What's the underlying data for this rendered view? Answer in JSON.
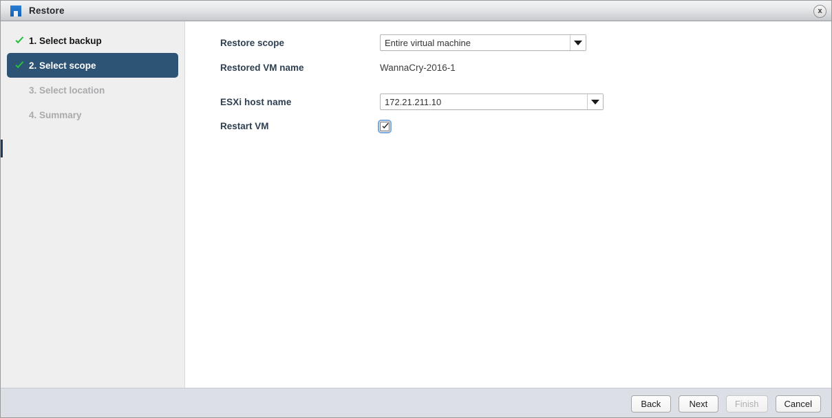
{
  "window": {
    "title": "Restore",
    "app_icon": "restore-app-icon",
    "close_icon": "close-icon",
    "close_label": "x"
  },
  "sidebar": {
    "steps": [
      {
        "label": "1. Select backup",
        "state": "done",
        "icon": "check-icon"
      },
      {
        "label": "2. Select scope",
        "state": "active",
        "icon": "check-icon"
      },
      {
        "label": "3. Select location",
        "state": "pending",
        "icon": "none"
      },
      {
        "label": "4. Summary",
        "state": "pending",
        "icon": "none"
      }
    ]
  },
  "form": {
    "restore_scope": {
      "label": "Restore scope",
      "value": "Entire virtual machine",
      "caret_icon": "chevron-down-icon"
    },
    "restored_vm_name": {
      "label": "Restored VM name",
      "value": "WannaCry-2016-1"
    },
    "esxi_host_name": {
      "label": "ESXi host name",
      "value": "172.21.211.10",
      "caret_icon": "chevron-down-icon"
    },
    "restart_vm": {
      "label": "Restart VM",
      "checked": true,
      "check_icon": "checkmark-icon"
    }
  },
  "footer": {
    "buttons": [
      {
        "label": "Back",
        "enabled": true
      },
      {
        "label": "Next",
        "enabled": true
      },
      {
        "label": "Finish",
        "enabled": false
      },
      {
        "label": "Cancel",
        "enabled": true
      }
    ]
  },
  "colors": {
    "active_step_bg": "#2d5375",
    "check_green": "#22c03c",
    "label_text": "#2c3e50",
    "footer_bg": "#dcdfe6",
    "sidebar_bg": "#efefef",
    "app_icon_blue": "#1569c7"
  }
}
